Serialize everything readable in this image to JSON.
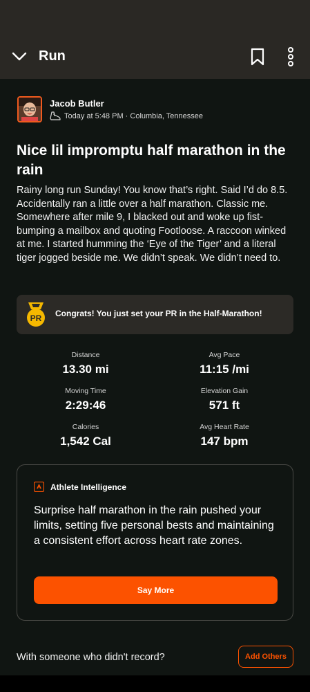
{
  "header": {
    "title": "Run"
  },
  "athlete": {
    "name": "Jacob Butler",
    "timestamp": "Today at 5:48 PM · Columbia, Tennessee"
  },
  "activity": {
    "title": "Nice lil impromptu half marathon in the rain",
    "description": "Rainy long run Sunday! You know that’s right. Said I’d do 8.5. Accidentally ran a little over a half marathon. Classic me. Somewhere after mile 9, I blacked out and woke up fist-bumping a mailbox and quoting Footloose. A raccoon winked at me. I started humming the ‘Eye of the Tiger’ and a literal tiger jogged beside me. We didn’t speak. We didn’t need to."
  },
  "pr": {
    "badge_text": "PR",
    "message": "Congrats! You just set your PR in the Half-Marathon!"
  },
  "stats": [
    {
      "label": "Distance",
      "value": "13.30 mi"
    },
    {
      "label": "Avg Pace",
      "value": "11:15 /mi"
    },
    {
      "label": "Moving Time",
      "value": "2:29:46"
    },
    {
      "label": "Elevation Gain",
      "value": "571 ft"
    },
    {
      "label": "Calories",
      "value": "1,542 Cal"
    },
    {
      "label": "Avg Heart Rate",
      "value": "147 bpm"
    }
  ],
  "ai": {
    "title": "Athlete Intelligence",
    "summary": "Surprise half marathon in the rain pushed your limits, setting five personal bests and maintaining a consistent effort across heart rate zones.",
    "button_label": "Say More"
  },
  "others": {
    "prompt": "With someone who didn't record?",
    "button_label": "Add Others"
  },
  "colors": {
    "accent": "#fc5200",
    "background": "#101512",
    "header": "#2a2824",
    "pr_gold": "#f5b800"
  },
  "icons": {
    "back": "chevron-down-icon",
    "bookmark": "bookmark-icon",
    "more": "more-vertical-icon",
    "shoe": "shoe-icon",
    "pr": "pr-medal-icon",
    "ai": "strava-logo-icon"
  }
}
